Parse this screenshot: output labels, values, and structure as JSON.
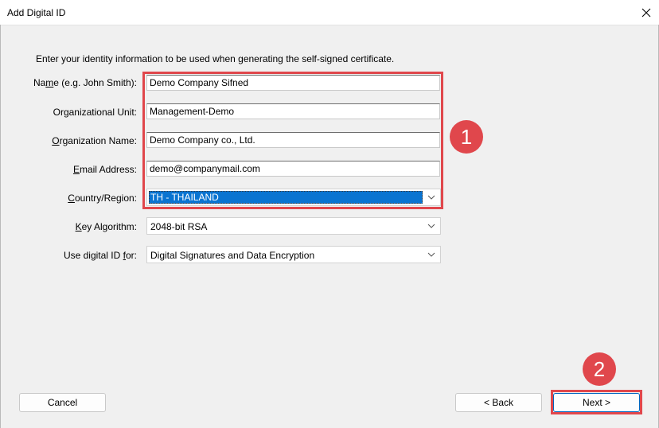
{
  "window": {
    "title": "Add Digital ID"
  },
  "instruction": "Enter your identity information to be used when generating the self-signed certificate.",
  "form": {
    "name": {
      "label_pre": "Na",
      "label_ul": "m",
      "label_post": "e (e.g. John Smith):",
      "value": "Demo Company Sifned"
    },
    "org_unit": {
      "label": "Organizational Unit:",
      "value": "Management-Demo"
    },
    "org_name": {
      "label_pre": "",
      "label_ul": "O",
      "label_post": "rganization Name:",
      "value": "Demo Company co., Ltd."
    },
    "email": {
      "label_pre": "",
      "label_ul": "E",
      "label_post": "mail Address:",
      "value": "demo@companymail.com"
    },
    "country": {
      "label_pre": "",
      "label_ul": "C",
      "label_post": "ountry/Region:",
      "value": "TH - THAILAND"
    },
    "key_algorithm": {
      "label_pre": "",
      "label_ul": "K",
      "label_post": "ey Algorithm:",
      "value": "2048-bit RSA"
    },
    "use_for": {
      "label_pre": "Use digital ID ",
      "label_ul": "f",
      "label_post": "or:",
      "value": "Digital Signatures and Data Encryption"
    }
  },
  "annotations": {
    "badge1": "1",
    "badge2": "2",
    "color": "#e0474c"
  },
  "buttons": {
    "cancel": "Cancel",
    "back": "< Back",
    "next": "Next >"
  },
  "colors": {
    "selection": "#0a74d1",
    "background": "#f0f0f0"
  }
}
